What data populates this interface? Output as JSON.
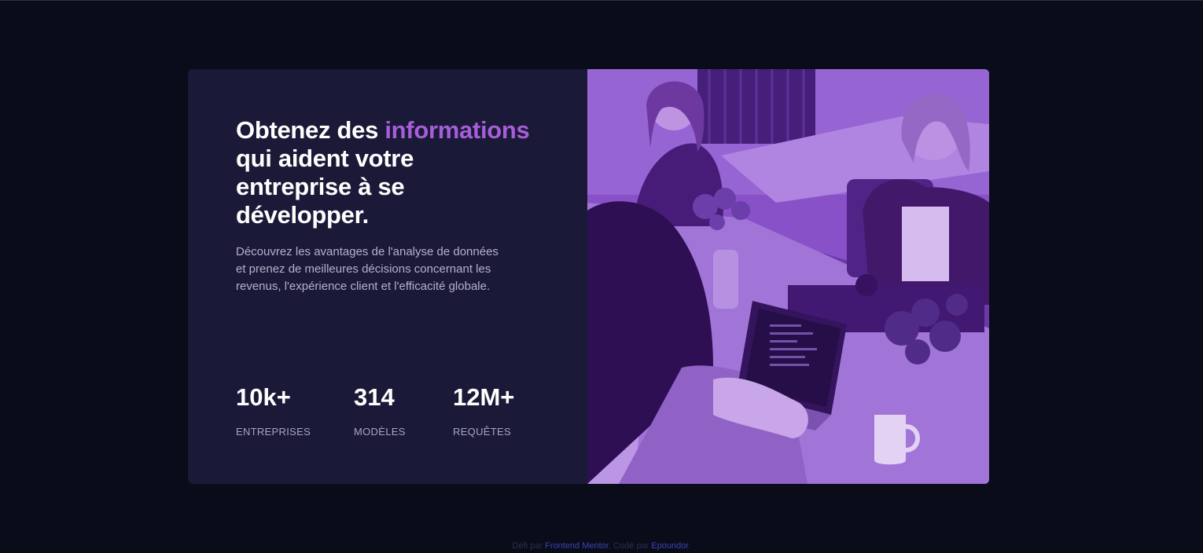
{
  "card": {
    "headline_part1": "Obtenez des",
    "headline_accent": "informations",
    "headline_part2": "qui aident votre entreprise à se développer.",
    "description": "Découvrez les avantages de l'analyse de données et prenez de meilleures décisions concernant les revenus, l'expérience client et l'efficacité globale.",
    "stats": [
      {
        "value": "10k+",
        "label": "ENTREPRISES"
      },
      {
        "value": "314",
        "label": "MODÈLES"
      },
      {
        "value": "12M+",
        "label": "REQUÊTES"
      }
    ],
    "image_tint": "#8a55c9"
  },
  "footer": {
    "prefix": "Défi par",
    "link1": "Frontend Mentor",
    "middle": ". Codé par",
    "link2": "Epoundor",
    "suffix": "."
  },
  "colors": {
    "background": "#0a0c1a",
    "card": "#1b1938",
    "accent": "#a65ed8",
    "text_muted": "#b4b1c8"
  }
}
